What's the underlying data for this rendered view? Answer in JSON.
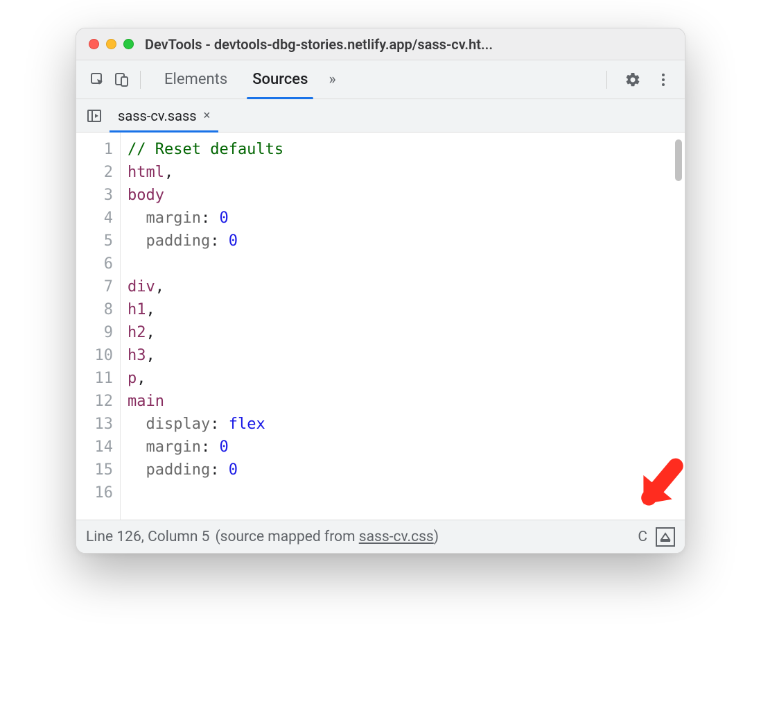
{
  "window": {
    "title": "DevTools - devtools-dbg-stories.netlify.app/sass-cv.ht..."
  },
  "toolbar": {
    "tabs": [
      {
        "label": "Elements",
        "active": false
      },
      {
        "label": "Sources",
        "active": true
      }
    ],
    "overflow_glyph": "»"
  },
  "filetab": {
    "name": "sass-cv.sass",
    "close_glyph": "×"
  },
  "code": {
    "lines": [
      {
        "n": 1,
        "segs": [
          {
            "t": "// Reset defaults",
            "c": "tok-comment"
          }
        ]
      },
      {
        "n": 2,
        "segs": [
          {
            "t": "html",
            "c": "tok-sel"
          },
          {
            "t": ",",
            "c": ""
          }
        ]
      },
      {
        "n": 3,
        "segs": [
          {
            "t": "body",
            "c": "tok-sel"
          }
        ]
      },
      {
        "n": 4,
        "segs": [
          {
            "t": "  margin",
            "c": "tok-prop"
          },
          {
            "t": ": ",
            "c": ""
          },
          {
            "t": "0",
            "c": "tok-val"
          }
        ]
      },
      {
        "n": 5,
        "segs": [
          {
            "t": "  padding",
            "c": "tok-prop"
          },
          {
            "t": ": ",
            "c": ""
          },
          {
            "t": "0",
            "c": "tok-val"
          }
        ]
      },
      {
        "n": 6,
        "segs": [
          {
            "t": "",
            "c": ""
          }
        ]
      },
      {
        "n": 7,
        "segs": [
          {
            "t": "div",
            "c": "tok-sel"
          },
          {
            "t": ",",
            "c": ""
          }
        ]
      },
      {
        "n": 8,
        "segs": [
          {
            "t": "h1",
            "c": "tok-sel"
          },
          {
            "t": ",",
            "c": ""
          }
        ]
      },
      {
        "n": 9,
        "segs": [
          {
            "t": "h2",
            "c": "tok-sel"
          },
          {
            "t": ",",
            "c": ""
          }
        ]
      },
      {
        "n": 10,
        "segs": [
          {
            "t": "h3",
            "c": "tok-sel"
          },
          {
            "t": ",",
            "c": ""
          }
        ]
      },
      {
        "n": 11,
        "segs": [
          {
            "t": "p",
            "c": "tok-sel"
          },
          {
            "t": ",",
            "c": ""
          }
        ]
      },
      {
        "n": 12,
        "segs": [
          {
            "t": "main",
            "c": "tok-sel"
          }
        ]
      },
      {
        "n": 13,
        "segs": [
          {
            "t": "  display",
            "c": "tok-prop"
          },
          {
            "t": ": ",
            "c": ""
          },
          {
            "t": "flex",
            "c": "tok-val"
          }
        ]
      },
      {
        "n": 14,
        "segs": [
          {
            "t": "  margin",
            "c": "tok-prop"
          },
          {
            "t": ": ",
            "c": ""
          },
          {
            "t": "0",
            "c": "tok-val"
          }
        ]
      },
      {
        "n": 15,
        "segs": [
          {
            "t": "  padding",
            "c": "tok-prop"
          },
          {
            "t": ": ",
            "c": ""
          },
          {
            "t": "0",
            "c": "tok-val"
          }
        ]
      },
      {
        "n": 16,
        "segs": [
          {
            "t": "",
            "c": ""
          }
        ]
      }
    ]
  },
  "status": {
    "cursor": "Line 126, Column 5",
    "mapped_prefix": "(source mapped from ",
    "mapped_link": "sass-cv.css",
    "mapped_suffix": ")",
    "trailing": " C"
  }
}
